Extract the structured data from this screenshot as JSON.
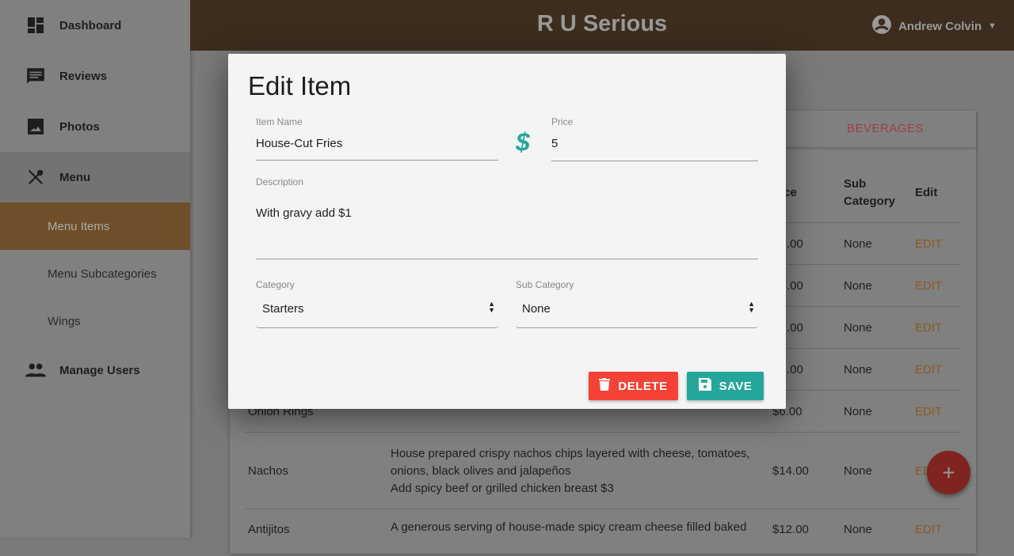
{
  "app": {
    "title": "R U Serious",
    "user": "Andrew Colvin"
  },
  "sidebar": {
    "items": [
      {
        "label": "Dashboard",
        "icon": "dashboard-icon"
      },
      {
        "label": "Reviews",
        "icon": "reviews-icon"
      },
      {
        "label": "Photos",
        "icon": "photo-icon"
      },
      {
        "label": "Menu",
        "icon": "utensils-icon"
      },
      {
        "label": "Manage Users",
        "icon": "users-icon"
      }
    ],
    "submenu": [
      {
        "label": "Menu Items",
        "active": true
      },
      {
        "label": "Menu Subcategories"
      },
      {
        "label": "Wings"
      }
    ]
  },
  "tabs": {
    "beverages": "BEVERAGES"
  },
  "table": {
    "headers": {
      "price": "ice",
      "sub": "Sub Category",
      "edit": "Edit"
    },
    "rows": [
      {
        "name": "",
        "desc": [],
        "price": ".00",
        "sub": "None",
        "edit": "EDIT"
      },
      {
        "name": "",
        "desc": [],
        "price": ".00",
        "sub": "None",
        "edit": "EDIT"
      },
      {
        "name": "",
        "desc": [],
        "price": ".00",
        "sub": "None",
        "edit": "EDIT"
      },
      {
        "name": "",
        "desc": [],
        "price": ".00",
        "sub": "None",
        "edit": "EDIT"
      },
      {
        "name": "Onion Rings",
        "desc": [],
        "price": "$6.00",
        "sub": "None",
        "edit": "EDIT"
      },
      {
        "name": "Nachos",
        "desc": [
          "House prepared crispy nachos chips layered with cheese, tomatoes,",
          "onions, black olives and jalapeños",
          "Add spicy beef or grilled chicken breast $3"
        ],
        "price": "$14.00",
        "sub": "None",
        "edit": "EDIT"
      },
      {
        "name": "Antijitos",
        "desc": [
          "A generous serving of house-made spicy cream cheese filled baked"
        ],
        "price": "$12.00",
        "sub": "None",
        "edit": "EDIT"
      }
    ]
  },
  "modal": {
    "title": "Edit Item",
    "item_name": {
      "label": "Item Name",
      "value": "House-Cut Fries"
    },
    "price": {
      "label": "Price",
      "value": "5"
    },
    "description": {
      "label": "Description",
      "value": "With gravy add $1"
    },
    "category": {
      "label": "Category",
      "value": "Starters"
    },
    "sub_category": {
      "label": "Sub Category",
      "value": "None"
    },
    "delete": "DELETE",
    "save": "SAVE"
  },
  "fab": "+",
  "colors": {
    "header": "#3c2d1e",
    "active_nav": "#6f4f29",
    "delete": "#f44336",
    "save": "#26a69a",
    "accent": "#26a69a"
  }
}
